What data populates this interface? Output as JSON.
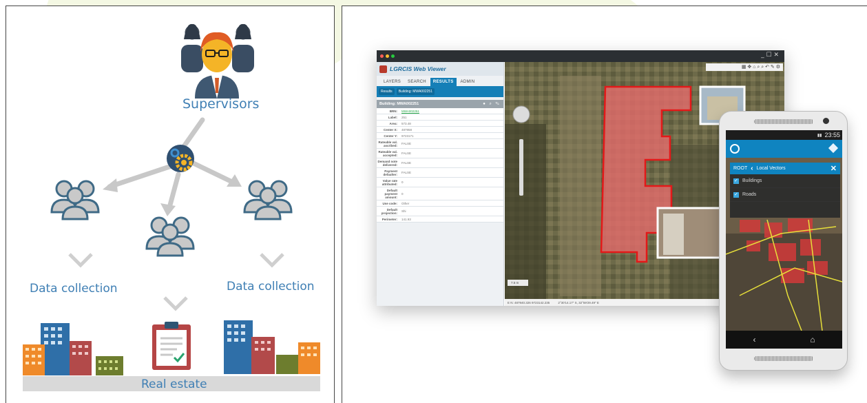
{
  "left": {
    "supervisors_label": "Supervisors",
    "data_collection_left": "Data collection",
    "data_collection_right": "Data collection",
    "real_estate_label": "Real estate"
  },
  "viewer": {
    "title": "LGRCIS Web Viewer",
    "tabs": [
      "LAYERS",
      "SEARCH",
      "RESULTS",
      "ADMIN"
    ],
    "active_tab": "RESULTS",
    "breadcrumbs": [
      "Results",
      "Building: MWA002251"
    ],
    "building_header": "Building: MWA002251",
    "attributes": [
      {
        "k": "BRN:",
        "v": "MWA002251"
      },
      {
        "k": "Label:",
        "v": "251"
      },
      {
        "k": "Area:",
        "v": "573.48"
      },
      {
        "k": "Center X:",
        "v": "487958"
      },
      {
        "k": "Center Y:",
        "v": "9723171"
      },
      {
        "k": "Rateable val. ascribed:",
        "v": "FALSE"
      },
      {
        "k": "Rateable val. accepted:",
        "v": "FALSE"
      },
      {
        "k": "Demand note delivered:",
        "v": "FALSE"
      },
      {
        "k": "Payment defaulter:",
        "v": "FALSE"
      },
      {
        "k": "Value rate attributed:",
        "v": "0"
      },
      {
        "k": "Default payment amount:",
        "v": "0"
      },
      {
        "k": "Use code:",
        "v": "Other"
      },
      {
        "k": "Default projection:",
        "v": "Shi"
      },
      {
        "k": "Perimeter:",
        "v": "141.93"
      }
    ],
    "coords_utm": "E N: 487940.326 9723142.235",
    "coords_dms": "2°30'14.17\" S, 32°59'29.49\" E",
    "scale_label": "7.5 m"
  },
  "phone": {
    "time": "23:55",
    "root_label": "ROOT",
    "menu_title": "Local Vectors",
    "items": [
      {
        "label": "Buildings",
        "checked": true
      },
      {
        "label": "Roads",
        "checked": true
      }
    ]
  },
  "colors": {
    "brand_blue": "#3f7fb4",
    "accent_blue": "#157fb7",
    "building_red": "#e31919"
  }
}
